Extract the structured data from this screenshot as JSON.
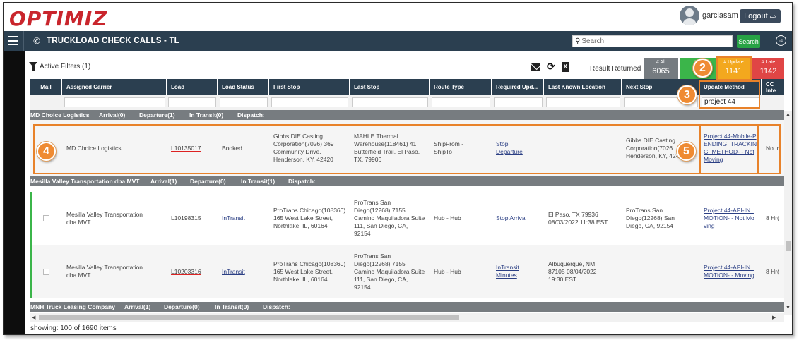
{
  "app": {
    "logo": "OPTIMIZ",
    "user": "garciasam",
    "logout": "Logout",
    "logout_icon": "⇨"
  },
  "nav": {
    "phone_icon": "✆",
    "title": "TRUCKLOAD CHECK CALLS - TL",
    "search_placeholder": "Search",
    "search_btn": "Search",
    "exit_icon": "⇨"
  },
  "toolbar": {
    "filters": "Active Filters (1)",
    "refresh_icon": "⟳",
    "xls_icon": "X",
    "result_returned": "Result Returned"
  },
  "counters": [
    {
      "label": "# All",
      "value": "6065",
      "color": "#757b80"
    },
    {
      "label": "# C",
      "value": "4",
      "color": "#3bb54a"
    },
    {
      "label": "# Update",
      "value": "1141",
      "color": "#f3a81e"
    },
    {
      "label": "# Late",
      "value": "1142",
      "color": "#e04545"
    }
  ],
  "columns": [
    "Mail",
    "Assigned Carrier",
    "Load",
    "Load Status",
    "First Stop",
    "Last Stop",
    "Route Type",
    "Required Upd...",
    "Last Known Location",
    "Next Stop",
    "Update Method",
    "CC Inte"
  ],
  "filter_value": "project 44",
  "groups": [
    {
      "carrier": "MD Choice Logistics",
      "arrival": "Arrival(0)",
      "departure": "Departure(1)",
      "transit": "In Transit(0)",
      "dispatch": "Dispatch:"
    },
    {
      "carrier": "Mesilla Valley Transportation dba MVT",
      "arrival": "Arrival(1)",
      "departure": "Departure(0)",
      "transit": "In Transit(1)",
      "dispatch": "Dispatch:"
    },
    {
      "carrier": "MNH Truck Leasing Company",
      "arrival": "Arrival(1)",
      "departure": "Departure(0)",
      "transit": "In Transit(0)",
      "dispatch": "Dispatch:"
    }
  ],
  "rows": [
    {
      "carrier": "MD Choice Logistics",
      "load": "L10135017",
      "status": "Booked",
      "first_stop": "Gibbs DIE Casting Corporation(7026) 369 Community Drive, Henderson, KY, 42420",
      "last_stop": "MAHLE Thermal Warehouse(118461) 41 Butterfield Trail, El Paso, TX, 79906",
      "route": "ShipFrom - ShipTo",
      "required": "Stop Departure",
      "last_loc": "",
      "next_stop": "Gibbs DIE Casting Corporation(7026 Henderson, KY, 424",
      "method": "Project 44-Mobile-PENDING_TRACKING_METHOD- - Not Moving",
      "cc": "No In"
    },
    {
      "carrier": "Mesilla Valley Transportation dba MVT",
      "load": "L10198315",
      "status": "InTransit",
      "first_stop": "ProTrans Chicago(108360) 165 West Lake Street, Northlake, IL, 60164",
      "last_stop": "ProTrans San Diego(12268) 7155 Camino Maquiladora Suite 111, San Diego, CA, 92154",
      "route": "Hub - Hub",
      "required": "Stop Arrival",
      "last_loc": "El Paso, TX 79936 08/03/2022 11:38 EST",
      "next_stop": "ProTrans San Diego(12268) San Diego, CA, 92154",
      "method": "Project 44-API-IN_MOTION- - Not Moving",
      "cc": "8 Hr("
    },
    {
      "carrier": "Mesilla Valley Transportation dba MVT",
      "load": "L10203316",
      "status": "InTransit",
      "first_stop": "ProTrans Chicago(108360) 165 West Lake Street, Northlake, IL, 60164",
      "last_stop": "ProTrans San Diego(12268) 7155 Camino Maquiladora Suite 111, San Diego, CA, 92154",
      "route": "Hub - Hub",
      "required": "InTransit Minutes",
      "last_loc": "Albuquerque, NM 87105 08/04/2022 19:30 EST",
      "next_stop": "",
      "method": "Project 44-API-IN_MOTION- - Moving",
      "cc": "8 Hr("
    }
  ],
  "footer": {
    "showing": "showing: 100 of 1690 items"
  },
  "callouts": [
    "2",
    "3",
    "4",
    "5"
  ],
  "scroll": {
    "up": "▲",
    "down": "▼",
    "left": "◀",
    "right": "▶"
  }
}
